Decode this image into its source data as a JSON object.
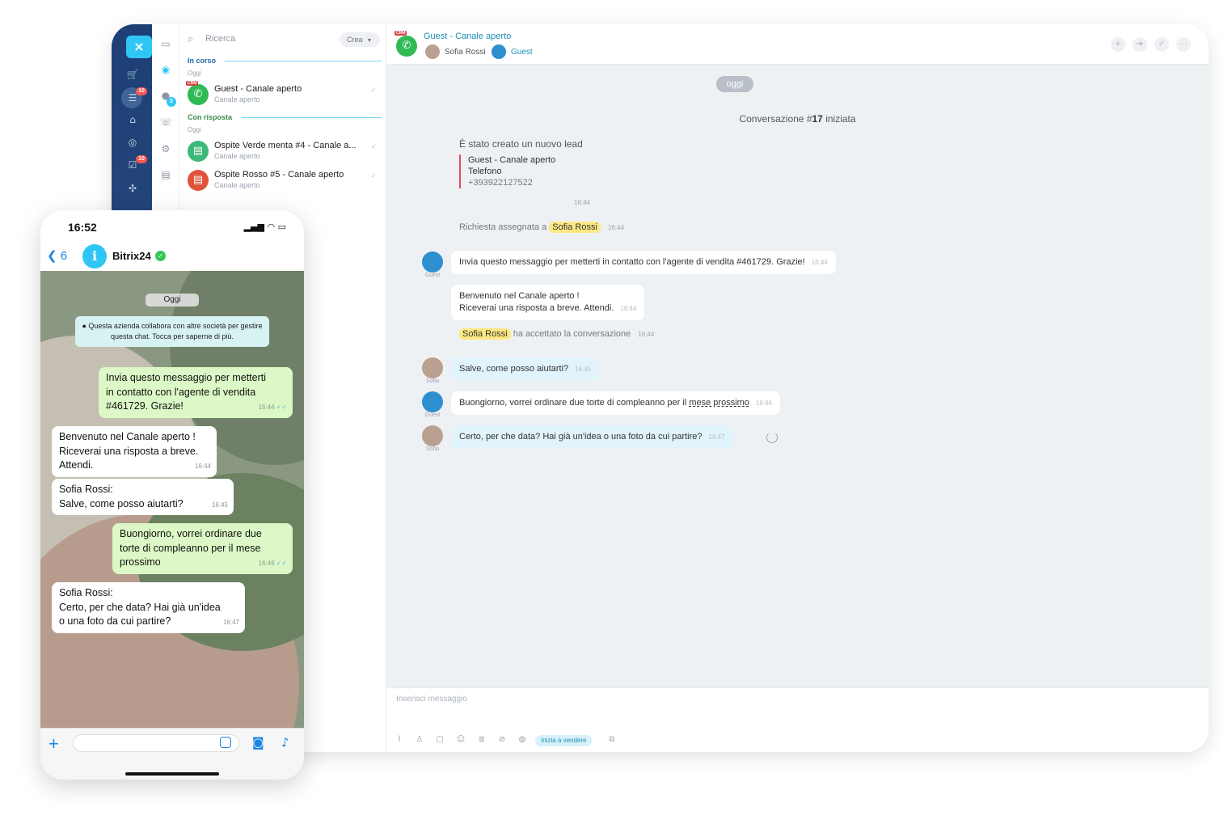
{
  "desktop": {
    "left_rail": {
      "close_label": "×",
      "badges": [
        "10",
        "10"
      ]
    },
    "second_rail": {
      "badge": "3"
    },
    "chat_list": {
      "search_placeholder": "Ricerca",
      "create_label": "Crea",
      "sections": [
        {
          "title": "In corso",
          "day": "Oggi",
          "items": [
            {
              "name": "Guest - Canale aperto",
              "sub": "Canale aperto",
              "crm": "CRM",
              "color": "#2fba55"
            }
          ]
        },
        {
          "title": "Con risposta",
          "day": "Oggi",
          "items": [
            {
              "name": "Ospite Verde menta #4 - Canale a...",
              "sub": "Canale aperto",
              "color": "#3cb878"
            },
            {
              "name": "Ospite Rosso #5 - Canale aperto",
              "sub": "Canale aperto",
              "color": "#e0533b"
            }
          ]
        }
      ]
    },
    "header": {
      "crm": "CRM",
      "title": "Guest - Canale aperto",
      "user": "Sofia Rossi",
      "guest": "Guest"
    },
    "chat": {
      "day_pill": "oggi",
      "conv_prefix": "Conversazione #",
      "conv_number": "17",
      "conv_suffix": " iniziata",
      "lead_title": "È stato creato un nuovo lead",
      "lead_card": {
        "name": "Guest - Canale aperto",
        "label": "Telefono",
        "phone": "+393922127522"
      },
      "lead_time": "16:44",
      "assigned": {
        "text": "Richiesta assegnata a",
        "name": "Sofia Rossi",
        "time": "16:44"
      },
      "accepted": {
        "name": "Sofia Rossi",
        "text": "ha accettato la conversazione",
        "time": "16:44"
      },
      "messages": [
        {
          "author": "Guest",
          "text": "Invia questo messaggio per metterti in contatto con l'agente di vendita #461729. Grazie!",
          "time": "16:44"
        },
        {
          "author": "",
          "line1": "Benvenuto nel Canale aperto !",
          "line2": "Riceverai una risposta a breve. Attendi.",
          "time": "16:44"
        },
        {
          "author": "Sofia",
          "text": "Salve, come posso aiutarti?",
          "time": "16:45"
        },
        {
          "author": "Guest",
          "text_a": "Buongiorno, vorrei ordinare due torte di compleanno per il ",
          "text_b": "mese prossimo",
          "time": "16:46"
        },
        {
          "author": "Sofia",
          "text": "Certo, per che data? Hai già un'idea o una foto da cui partire?",
          "time": "16:47"
        }
      ]
    },
    "composer": {
      "placeholder": "Inserisci messaggio",
      "sell_button": "Inizia a vendere"
    }
  },
  "phone": {
    "status_time": "16:52",
    "back_count": "6",
    "contact": "Bitrix24",
    "day": "Oggi",
    "notice": "Questa azienda collabora con altre società per gestire questa chat. Tocca per saperne di più.",
    "messages": [
      {
        "dir": "out",
        "lines": [
          "Invia questo messaggio per metterti",
          "in contatto con l'agente di vendita",
          "#461729. Grazie!"
        ],
        "time": "16:44"
      },
      {
        "dir": "in",
        "lines": [
          "Benvenuto nel Canale aperto !",
          "Riceverai una risposta a breve.",
          "Attendi."
        ],
        "time": "16:44"
      },
      {
        "dir": "in",
        "lines": [
          "Sofia Rossi:",
          "Salve, come posso aiutarti?"
        ],
        "time": "16:45"
      },
      {
        "dir": "out",
        "lines": [
          "Buongiorno, vorrei ordinare due",
          "torte di compleanno per il mese",
          "prossimo"
        ],
        "time": "16:46"
      },
      {
        "dir": "in",
        "lines": [
          "Sofia Rossi:",
          "Certo, per che data? Hai già un'idea",
          "o una foto da cui partire?"
        ],
        "time": "16:47"
      }
    ]
  }
}
